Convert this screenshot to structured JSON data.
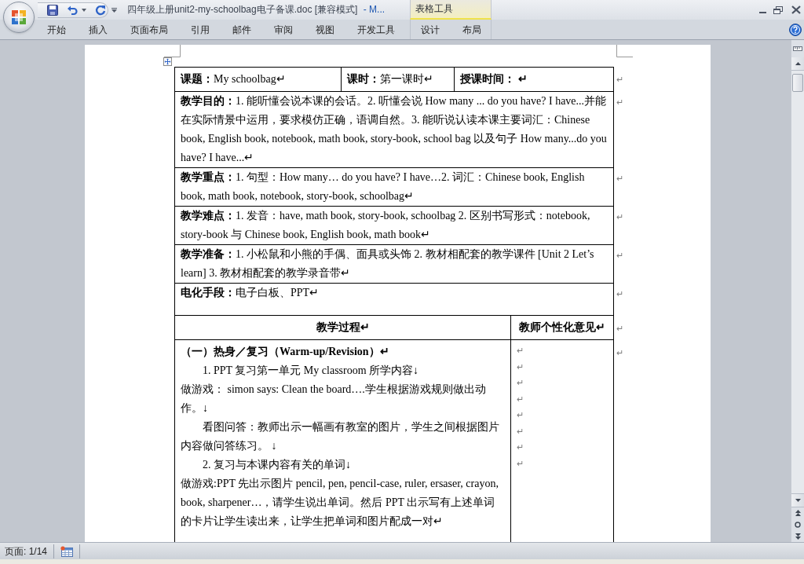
{
  "window": {
    "document_title": "四年级上册unit2-my-schoolbag电子备课.doc [兼容模式]",
    "app_title": "- M..."
  },
  "ribbon": {
    "tabs": [
      {
        "label": "开始",
        "selected": false
      },
      {
        "label": "插入",
        "selected": false
      },
      {
        "label": "页面布局",
        "selected": false
      },
      {
        "label": "引用",
        "selected": false
      },
      {
        "label": "邮件",
        "selected": false
      },
      {
        "label": "审阅",
        "selected": false
      },
      {
        "label": "视图",
        "selected": false
      },
      {
        "label": "开发工具",
        "selected": false
      }
    ],
    "contextual_group": {
      "label": "表格工具",
      "tabs": [
        {
          "label": "设计",
          "selected": false
        },
        {
          "label": "布局",
          "selected": false
        }
      ]
    }
  },
  "document": {
    "table_rows": [
      {
        "kind": "triple",
        "end_mark": "↵",
        "cells": [
          {
            "paragraphs": [
              {
                "text": "**课题：**My schoolbag↵"
              }
            ]
          },
          {
            "paragraphs": [
              {
                "text": "**课时：**第一课时↵"
              }
            ]
          },
          {
            "paragraphs": [
              {
                "kind": "bold",
                "text": "授课时间： ↵"
              }
            ]
          }
        ]
      },
      {
        "kind": "single",
        "end_mark": "↵",
        "cells": [
          {
            "paragraphs": [
              {
                "text": "**教学目的：**1. 能听懂会说本课的会话。2. 听懂会说 How many ... do you have? I have...并能在实际情景中运用，要求模仿正确，语调自然。3. 能听说认读本课主要词汇：Chinese book, English book, notebook, math book, story-book, school bag 以及句子 How many...do you have? I have...↵"
              }
            ]
          }
        ]
      },
      {
        "kind": "single",
        "end_mark": "↵",
        "cells": [
          {
            "paragraphs": [
              {
                "text": "**教学重点：**1. 句型：How many… do you have? I have…2. 词汇：Chinese book, English book, math book, notebook, story-book, schoolbag↵"
              }
            ]
          }
        ]
      },
      {
        "kind": "single",
        "end_mark": "↵",
        "cells": [
          {
            "paragraphs": [
              {
                "text": "**教学难点：**1. 发音：have, math book, story-book, schoolbag 2. 区别书写形式：notebook, story-book 与 Chinese book, English book, math book↵"
              }
            ]
          }
        ]
      },
      {
        "kind": "single",
        "end_mark": "↵",
        "cells": [
          {
            "paragraphs": [
              {
                "text": "**教学准备：**1. 小松鼠和小熊的手偶、面具或头饰 2. 教材相配套的教学课件 [Unit 2 Let’s learn] 3. 教材相配套的教学录音带↵"
              }
            ]
          }
        ]
      },
      {
        "kind": "single",
        "end_mark": "↵",
        "cells": [
          {
            "paragraphs": [
              {
                "text": "**电化手段：**电子白板、PPT↵"
              }
            ]
          }
        ]
      },
      {
        "kind": "header",
        "end_mark": "↵",
        "cells": [
          {
            "paragraphs": [
              {
                "kind": "bold",
                "text": "教学过程↵"
              }
            ]
          },
          {
            "paragraphs": [
              {
                "kind": "bold",
                "text": "教师个性化意见↵"
              }
            ]
          }
        ]
      },
      {
        "kind": "split",
        "end_mark": "↵",
        "cells": [
          {
            "paragraphs": [
              {
                "kind": "heading",
                "text": "（一）热身／复习（Warm-up/Revision）↵"
              },
              {
                "kind": "indent",
                "text": "1. PPT 复习第一单元 My classroom 所学内容↓"
              },
              {
                "kind": "plain",
                "text": "做游戏： simon says: Clean the board….学生根据游戏规则做出动作。↓"
              },
              {
                "kind": "indent",
                "text": "看图问答：教师出示一幅画有教室的图片，学生之间根据图片内容做问答练习。 ↓"
              },
              {
                "kind": "indent",
                "text": "2. 复习与本课内容有关的单词↓"
              },
              {
                "kind": "plain",
                "text": "做游戏:PPT 先出示图片 pencil, pen, pencil-case, ruler, ersaser, crayon, book, sharpener…，请学生说出单词。然后 PPT 出示写有上述单词的卡片让学生读出来，让学生把单词和图片配成一对↵"
              }
            ]
          },
          {
            "paragraphs": [
              {
                "kind": "mark",
                "text": "↵"
              },
              {
                "kind": "mark",
                "text": "↵"
              },
              {
                "kind": "mark",
                "text": "↵"
              },
              {
                "kind": "mark",
                "text": "↵"
              },
              {
                "kind": "mark",
                "text": "↵"
              },
              {
                "kind": "mark",
                "text": "↵"
              },
              {
                "kind": "mark",
                "text": "↵"
              },
              {
                "kind": "mark",
                "text": "↵"
              }
            ]
          }
        ]
      }
    ]
  },
  "status_bar": {
    "page": "页面: 1/14"
  }
}
